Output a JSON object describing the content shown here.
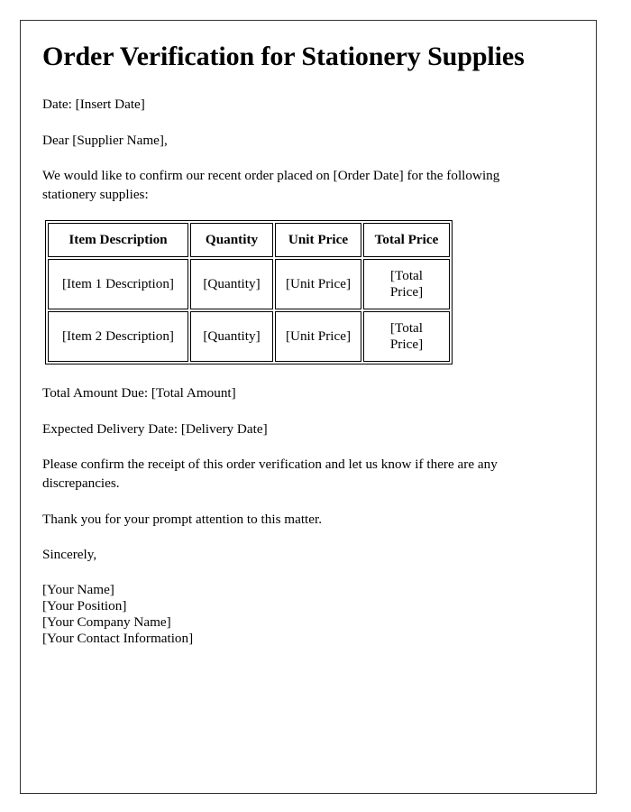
{
  "document": {
    "title": "Order Verification for Stationery Supplies",
    "date_line": "Date: [Insert Date]",
    "salutation": "Dear [Supplier Name],",
    "intro": "We would like to confirm our recent order placed on [Order Date] for the following stationery supplies:",
    "total_amount_line": "Total Amount Due: [Total Amount]",
    "delivery_date_line": "Expected Delivery Date: [Delivery Date]",
    "confirmation_request": "Please confirm the receipt of this order verification and let us know if there are any discrepancies.",
    "thanks": "Thank you for your prompt attention to this matter.",
    "closing": "Sincerely,",
    "signature": [
      "[Your Name]",
      "[Your Position]",
      "[Your Company Name]",
      "[Your Contact Information]"
    ]
  },
  "table": {
    "headers": [
      "Item Description",
      "Quantity",
      "Unit Price",
      "Total Price"
    ],
    "rows": [
      [
        "[Item 1 Description]",
        "[Quantity]",
        "[Unit Price]",
        "[Total Price]"
      ],
      [
        "[Item 2 Description]",
        "[Quantity]",
        "[Unit Price]",
        "[Total Price]"
      ]
    ]
  },
  "colors": {
    "page_border": "#333333",
    "table_border": "#000000",
    "text": "#000000",
    "background": "#ffffff"
  }
}
